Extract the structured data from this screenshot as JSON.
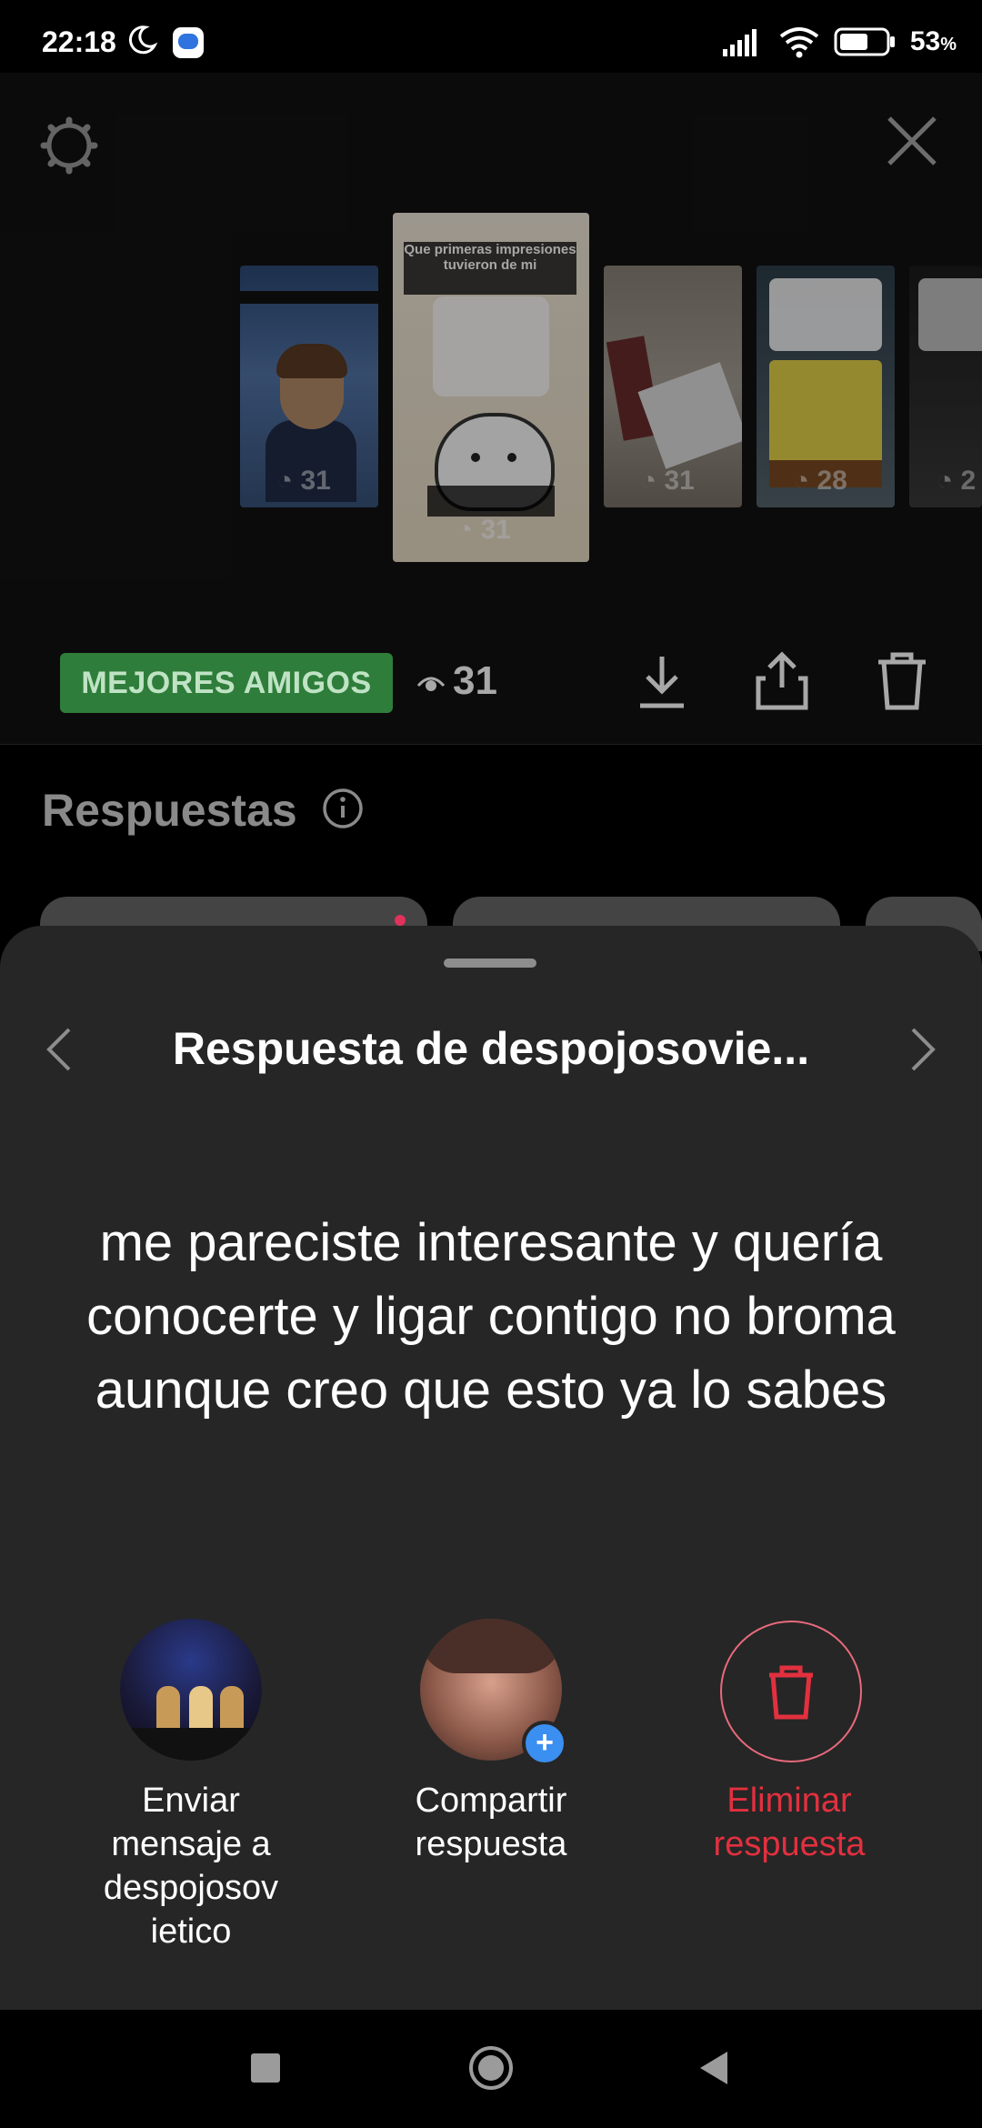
{
  "status_bar": {
    "time": "22:18",
    "battery_percent": "53",
    "battery_unit": "%"
  },
  "story_strip": {
    "thumbnails": [
      {
        "views": "31"
      },
      {
        "views": "31",
        "caption": "Que primeras impresiones tuvieron de mi",
        "selected": true
      },
      {
        "views": "31"
      },
      {
        "views": "28"
      },
      {
        "views": "2"
      }
    ]
  },
  "info_bar": {
    "audience_badge": "MEJORES AMIGOS",
    "views": "31",
    "badge_color": "#2f7d3a"
  },
  "responses": {
    "title": "Respuestas"
  },
  "sheet": {
    "title": "Respuesta de despojosovie...",
    "answer_text": "me pareciste interesante y quería conocerte y ligar contigo no broma aunque creo que esto ya lo sabes",
    "actions": [
      {
        "label": "Enviar mensaje a despojosov ietico"
      },
      {
        "label": "Compartir respuesta"
      },
      {
        "label": "Eliminar respuesta",
        "color": "#e2303f"
      }
    ]
  }
}
